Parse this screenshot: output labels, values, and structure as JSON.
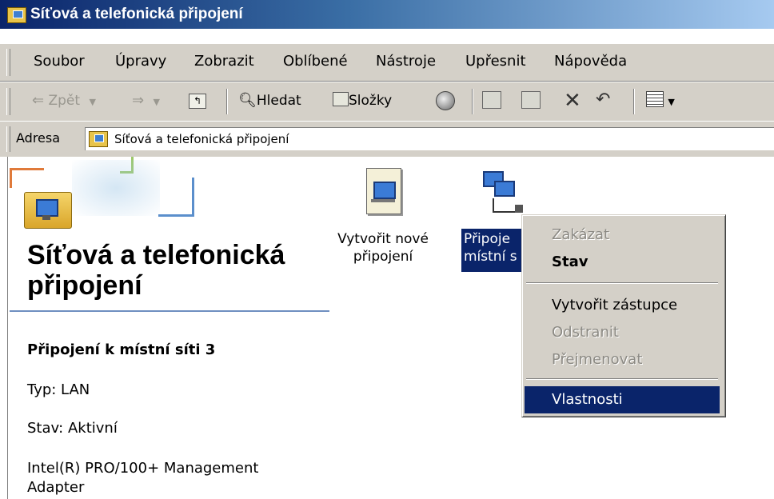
{
  "window": {
    "title": "Síťová a telefonická připojení"
  },
  "menu": {
    "items": [
      "Soubor",
      "Úpravy",
      "Zobrazit",
      "Oblíbené",
      "Nástroje",
      "Upřesnit",
      "Nápověda"
    ]
  },
  "toolbar": {
    "back_label": "Zpět",
    "search_label": "Hledat",
    "folders_label": "Složky"
  },
  "address": {
    "label": "Adresa",
    "value": "Síťová a telefonická připojení"
  },
  "panel": {
    "title": "Síťová a telefonická\npřipojení",
    "connection_name": "Připojení k místní síti 3",
    "type": "Typ: LAN",
    "status": "Stav: Aktivní",
    "adapter": "Intel(R) PRO/100+ Management\nAdapter"
  },
  "icons": {
    "new_connection_label": "Vytvořit nové\npřipojení",
    "local_connection_label": "Připoje\nmístní s"
  },
  "context_menu": {
    "items": [
      {
        "label": "Zakázat",
        "state": "disabled"
      },
      {
        "label": "Stav",
        "state": "default"
      },
      {
        "label": "Vytvořit zástupce",
        "state": "enabled"
      },
      {
        "label": "Odstranit",
        "state": "disabled"
      },
      {
        "label": "Přejmenovat",
        "state": "disabled"
      },
      {
        "label": "Vlastnosti",
        "state": "highlighted"
      }
    ]
  },
  "colors": {
    "titlebar": "#0a246a",
    "selection": "#0a246a",
    "chrome": "#d4d0c8"
  }
}
